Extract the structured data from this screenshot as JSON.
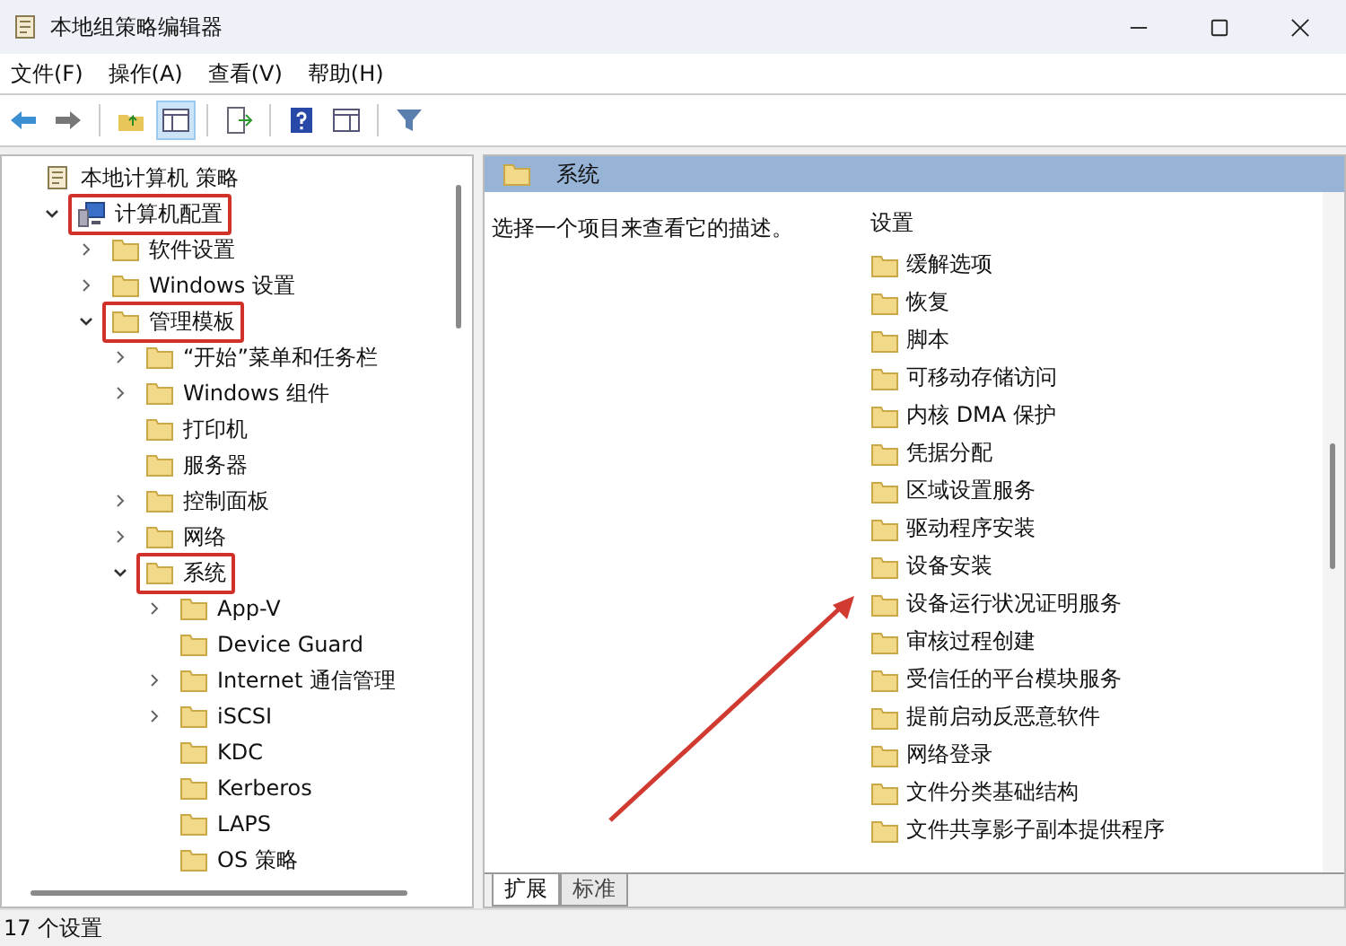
{
  "window": {
    "title": "本地组策略编辑器"
  },
  "menu": [
    "文件(F)",
    "操作(A)",
    "查看(V)",
    "帮助(H)"
  ],
  "toolbar": [
    {
      "kind": "back",
      "pressed": false
    },
    {
      "kind": "forward",
      "pressed": false
    },
    {
      "kind": "separator",
      "pressed": false
    },
    {
      "kind": "up",
      "pressed": false
    },
    {
      "kind": "tree",
      "pressed": true
    },
    {
      "kind": "separator",
      "pressed": false
    },
    {
      "kind": "export",
      "pressed": false
    },
    {
      "kind": "separator",
      "pressed": false
    },
    {
      "kind": "help",
      "pressed": false
    },
    {
      "kind": "details",
      "pressed": false
    },
    {
      "kind": "separator",
      "pressed": false
    },
    {
      "kind": "filter",
      "pressed": false
    }
  ],
  "tree": [
    {
      "label": "本地计算机 策略",
      "kind": "root",
      "highlighted": false,
      "children": [
        {
          "label": "计算机配置",
          "kind": "computer",
          "expanded": true,
          "highlighted": true,
          "children": [
            {
              "label": "软件设置",
              "kind": "folder",
              "expanded": false,
              "highlighted": false
            },
            {
              "label": "Windows 设置",
              "kind": "folder",
              "expanded": false,
              "highlighted": false
            },
            {
              "label": "管理模板",
              "kind": "folder",
              "expanded": true,
              "highlighted": true,
              "children": [
                {
                  "label": "“开始”菜单和任务栏",
                  "kind": "folder",
                  "expanded": false,
                  "highlighted": false
                },
                {
                  "label": "Windows 组件",
                  "kind": "folder",
                  "expanded": false,
                  "highlighted": false
                },
                {
                  "label": "打印机",
                  "kind": "folder",
                  "highlighted": false
                },
                {
                  "label": "服务器",
                  "kind": "folder",
                  "highlighted": false
                },
                {
                  "label": "控制面板",
                  "kind": "folder",
                  "expanded": false,
                  "highlighted": false
                },
                {
                  "label": "网络",
                  "kind": "folder",
                  "expanded": false,
                  "highlighted": false
                },
                {
                  "label": "系统",
                  "kind": "folder",
                  "expanded": true,
                  "highlighted": true,
                  "children": [
                    {
                      "label": "App-V",
                      "kind": "folder",
                      "expanded": false,
                      "highlighted": false
                    },
                    {
                      "label": "Device Guard",
                      "kind": "folder",
                      "highlighted": false
                    },
                    {
                      "label": "Internet 通信管理",
                      "kind": "folder",
                      "expanded": false,
                      "highlighted": false
                    },
                    {
                      "label": "iSCSI",
                      "kind": "folder",
                      "expanded": false,
                      "highlighted": false
                    },
                    {
                      "label": "KDC",
                      "kind": "folder",
                      "highlighted": false
                    },
                    {
                      "label": "Kerberos",
                      "kind": "folder",
                      "highlighted": false
                    },
                    {
                      "label": "LAPS",
                      "kind": "folder",
                      "highlighted": false
                    },
                    {
                      "label": "OS 策略",
                      "kind": "folder",
                      "highlighted": false
                    }
                  ]
                }
              ]
            }
          ]
        }
      ]
    }
  ],
  "details": {
    "title": "系统",
    "description": "选择一个项目来查看它的描述。",
    "column": "设置",
    "items": [
      "缓解选项",
      "恢复",
      "脚本",
      "可移动存储访问",
      "内核 DMA 保护",
      "凭据分配",
      "区域设置服务",
      "驱动程序安装",
      "设备安装",
      "设备运行状况证明服务",
      "审核过程创建",
      "受信任的平台模块服务",
      "提前启动反恶意软件",
      "网络登录",
      "文件分类基础结构",
      "文件共享影子副本提供程序"
    ]
  },
  "tabs": [
    {
      "label": "扩展",
      "selected": true
    },
    {
      "label": "标准",
      "selected": false
    }
  ],
  "status_bar": "17 个设置"
}
